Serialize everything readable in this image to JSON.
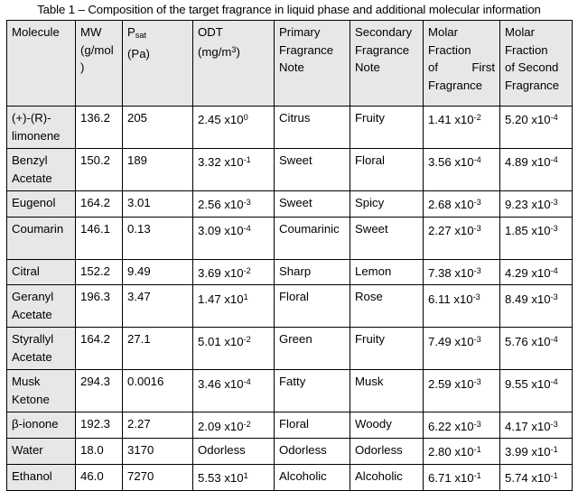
{
  "caption": "Table 1 – Composition of the target fragrance in liquid phase and additional molecular information",
  "table": {
    "headers": [
      {
        "line1": "Molecule",
        "line2": "",
        "line3": "",
        "line4": ""
      },
      {
        "line1": "MW",
        "line2": "(g/mol)",
        "line3": "",
        "line4": ""
      },
      {
        "line1": "P",
        "sub": "sat",
        "line2": "(Pa)",
        "line3": "",
        "line4": ""
      },
      {
        "line1": "ODT",
        "line2": "(mg/m",
        "sup": "3",
        "line2b": ")",
        "line3": "",
        "line4": ""
      },
      {
        "line1": "Primary",
        "line2": "Fragrance",
        "line3": "Note",
        "line4": ""
      },
      {
        "line1": "Secondary",
        "line2": "Fragrance",
        "line3": "Note",
        "line4": ""
      },
      {
        "line1": "Molar",
        "line2": "Fraction",
        "line3": "of First",
        "line4": "Fragrance"
      },
      {
        "line1": "Molar",
        "line2": "Fraction",
        "line3": "of Second",
        "line4": "Fragrance"
      }
    ],
    "header_labels": [
      "Molecule",
      "MW (g/mol)",
      "Psat (Pa)",
      "ODT (mg/m3)",
      "Primary Fragrance Note",
      "Secondary Fragrance Note",
      "Molar Fraction of First Fragrance",
      "Molar Fraction of Second Fragrance"
    ],
    "rows": [
      {
        "molecule": "(+)-(R)-limonene",
        "mw": "136.2",
        "psat": "205",
        "odt_mant": "2.45 x10",
        "odt_exp": "0",
        "primary": "Citrus",
        "secondary": "Fruity",
        "x1_mant": "1.41 x10",
        "x1_exp": "-2",
        "x2_mant": "5.20 x10",
        "x2_exp": "-4"
      },
      {
        "molecule": "Benzyl Acetate",
        "mw": "150.2",
        "psat": "189",
        "odt_mant": "3.32 x10",
        "odt_exp": "-1",
        "primary": "Sweet",
        "secondary": "Floral",
        "x1_mant": "3.56 x10",
        "x1_exp": "-4",
        "x2_mant": "4.89 x10",
        "x2_exp": "-4"
      },
      {
        "molecule": "Eugenol",
        "mw": "164.2",
        "psat": "3.01",
        "odt_mant": "2.56 x10",
        "odt_exp": "-3",
        "primary": "Sweet",
        "secondary": "Spicy",
        "x1_mant": "2.68 x10",
        "x1_exp": "-3",
        "x2_mant": "9.23 x10",
        "x2_exp": "-3"
      },
      {
        "molecule": "Coumarin",
        "mw": "146.1",
        "psat": "0.13",
        "odt_mant": "3.09 x10",
        "odt_exp": "-4",
        "primary": "Coumarinic",
        "secondary": "Sweet",
        "x1_mant": "2.27 x10",
        "x1_exp": "-3",
        "x2_mant": "1.85 x10",
        "x2_exp": "-3"
      },
      {
        "molecule": "Citral",
        "mw": "152.2",
        "psat": "9.49",
        "odt_mant": "3.69 x10",
        "odt_exp": "-2",
        "primary": "Sharp",
        "secondary": "Lemon",
        "x1_mant": "7.38 x10",
        "x1_exp": "-3",
        "x2_mant": "4.29 x10",
        "x2_exp": "-4"
      },
      {
        "molecule": "Geranyl Acetate",
        "mw": "196.3",
        "psat": "3.47",
        "odt_mant": "1.47 x10",
        "odt_exp": "1",
        "primary": "Floral",
        "secondary": "Rose",
        "x1_mant": "6.11 x10",
        "x1_exp": "-3",
        "x2_mant": "8.49 x10",
        "x2_exp": "-3"
      },
      {
        "molecule": "Styrallyl Acetate",
        "mw": "164.2",
        "psat": "27.1",
        "odt_mant": "5.01 x10",
        "odt_exp": "-2",
        "primary": "Green",
        "secondary": "Fruity",
        "x1_mant": "7.49 x10",
        "x1_exp": "-3",
        "x2_mant": "5.76 x10",
        "x2_exp": "-4"
      },
      {
        "molecule": "Musk Ketone",
        "mw": "294.3",
        "psat": "0.0016",
        "odt_mant": "3.46 x10",
        "odt_exp": "-4",
        "primary": "Fatty",
        "secondary": "Musk",
        "x1_mant": "2.59 x10",
        "x1_exp": "-3",
        "x2_mant": "9.55 x10",
        "x2_exp": "-4"
      },
      {
        "molecule": "β-ionone",
        "mw": "192.3",
        "psat": "2.27",
        "odt_mant": "2.09 x10",
        "odt_exp": "-2",
        "primary": "Floral",
        "secondary": "Woody",
        "x1_mant": "6.22 x10",
        "x1_exp": "-3",
        "x2_mant": "4.17 x10",
        "x2_exp": "-3"
      },
      {
        "molecule": "Water",
        "mw": "18.0",
        "psat": "3170",
        "odt_mant": "Odorless",
        "odt_exp": "",
        "primary": "Odorless",
        "secondary": "Odorless",
        "x1_mant": "2.80 x10",
        "x1_exp": "-1",
        "x2_mant": "3.99 x10",
        "x2_exp": "-1"
      },
      {
        "molecule": "Ethanol",
        "mw": "46.0",
        "psat": "7270",
        "odt_mant": "5.53 x10",
        "odt_exp": "1",
        "primary": "Alcoholic",
        "secondary": "Alcoholic",
        "x1_mant": "6.71 x10",
        "x1_exp": "-1",
        "x2_mant": "5.74 x10",
        "x2_exp": "-1"
      }
    ]
  },
  "colors": {
    "header_bg": "#e7e7e7",
    "first_column_bg": "#e7e7e7",
    "border": "#000000",
    "text": "#000000",
    "page_bg": "#ffffff"
  }
}
